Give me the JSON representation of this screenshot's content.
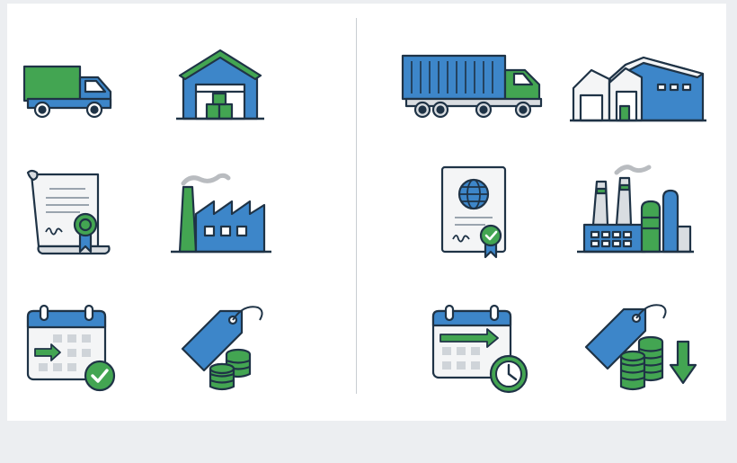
{
  "colors": {
    "outline": "#1f3346",
    "blue": "#3d86c9",
    "green": "#43a552",
    "gray": "#d9dde1",
    "paper": "#f4f5f6",
    "white": "#ffffff",
    "smoke": "#b9bcc0"
  },
  "icon_sets": [
    {
      "set": "left",
      "icons": [
        "box-truck-icon",
        "warehouse-icon",
        "certificate-scroll-icon",
        "factory-icon",
        "calendar-checkmark-icon",
        "price-tag-coins-icon"
      ]
    },
    {
      "set": "right",
      "icons": [
        "container-truck-icon",
        "large-warehouse-icon",
        "passport-certificate-icon",
        "industrial-plant-icon",
        "calendar-clock-icon",
        "price-tag-coins-down-arrow-icon"
      ]
    }
  ]
}
